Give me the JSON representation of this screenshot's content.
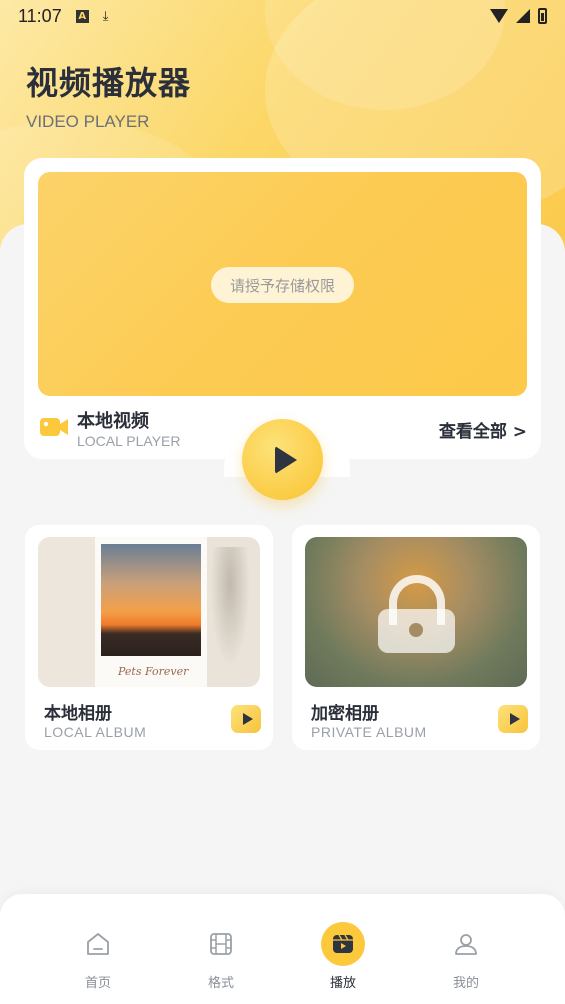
{
  "status_bar": {
    "time": "11:07"
  },
  "header": {
    "title": "视频播放器",
    "subtitle": "VIDEO PLAYER"
  },
  "local_video": {
    "permission_prompt": "请授予存储权限",
    "label": "本地视频",
    "sublabel": "LOCAL PLAYER",
    "view_all": "查看全部 >"
  },
  "albums": [
    {
      "title": "本地相册",
      "subtitle": "LOCAL ALBUM",
      "photo_caption": "Pets Forever"
    },
    {
      "title": "加密相册",
      "subtitle": "PRIVATE ALBUM"
    }
  ],
  "bottom_nav": [
    {
      "label": "首页",
      "icon": "home-icon",
      "active": false
    },
    {
      "label": "格式",
      "icon": "film-icon",
      "active": false
    },
    {
      "label": "播放",
      "icon": "play-video-icon",
      "active": true
    },
    {
      "label": "我的",
      "icon": "user-icon",
      "active": false
    }
  ],
  "colors": {
    "accent": "#fcc93d",
    "text_dark": "#2b2f3a",
    "text_muted": "#9aa0a8"
  }
}
